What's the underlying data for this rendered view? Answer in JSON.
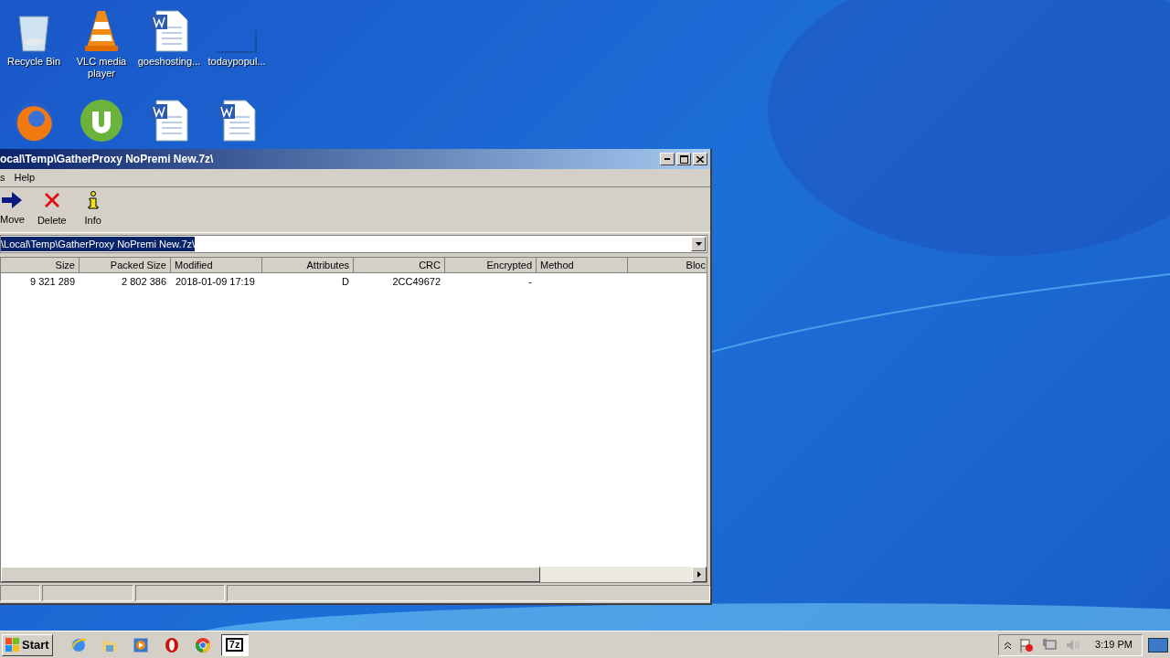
{
  "desktop_icons": [
    {
      "label": "Recycle Bin",
      "kind": "bin"
    },
    {
      "label": "VLC media player",
      "kind": "cone"
    },
    {
      "label": "goeshosting...",
      "kind": "doc"
    },
    {
      "label": "todaypopul...",
      "kind": "blank"
    },
    {
      "kind": "firefox"
    },
    {
      "kind": "torrent"
    },
    {
      "kind": "doc"
    },
    {
      "kind": "doc"
    }
  ],
  "window": {
    "title": "ocal\\Temp\\GatherProxy NoPremi New.7z\\",
    "menu": [
      "s",
      "Help"
    ],
    "toolbar": [
      {
        "label": "Move",
        "kind": "move"
      },
      {
        "label": "Delete",
        "kind": "delete"
      },
      {
        "label": "Info",
        "kind": "info"
      }
    ],
    "address": "\\Local\\Temp\\GatherProxy NoPremi New.7z\\",
    "columns": [
      {
        "label": "Size"
      },
      {
        "label": "Packed Size"
      },
      {
        "label": "Modified"
      },
      {
        "label": "Attributes"
      },
      {
        "label": "CRC"
      },
      {
        "label": "Encrypted"
      },
      {
        "label": "Method"
      },
      {
        "label": "Bloc"
      }
    ],
    "rows": [
      [
        "9 321 289",
        "2 802 386",
        "2018-01-09 17:19",
        "D",
        "2CC49672",
        "-"
      ]
    ]
  },
  "taskbar": {
    "start": "Start",
    "items": [
      {
        "kind": "ie",
        "selected": false
      },
      {
        "kind": "folder",
        "selected": false
      },
      {
        "kind": "media",
        "selected": false
      },
      {
        "kind": "opera",
        "selected": false
      },
      {
        "kind": "chrome",
        "selected": false
      },
      {
        "kind": "sevenzip",
        "label": "7z",
        "selected": true
      }
    ],
    "clock": "3:19 PM"
  }
}
